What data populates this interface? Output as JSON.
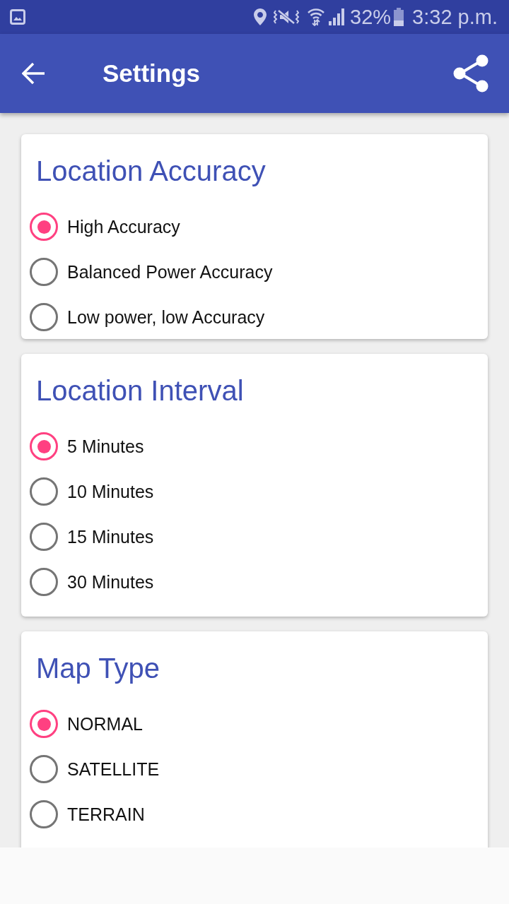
{
  "status_bar": {
    "battery": "32%",
    "time": "3:32 p.m."
  },
  "app_bar": {
    "title": "Settings"
  },
  "sections": [
    {
      "title": "Location Accuracy",
      "options": [
        {
          "label": "High Accuracy",
          "selected": true
        },
        {
          "label": "Balanced Power Accuracy",
          "selected": false
        },
        {
          "label": "Low power, low Accuracy",
          "selected": false
        }
      ]
    },
    {
      "title": "Location Interval",
      "options": [
        {
          "label": "5 Minutes",
          "selected": true
        },
        {
          "label": "10 Minutes",
          "selected": false
        },
        {
          "label": "15 Minutes",
          "selected": false
        },
        {
          "label": "30 Minutes",
          "selected": false
        }
      ]
    },
    {
      "title": "Map Type",
      "options": [
        {
          "label": "NORMAL",
          "selected": true
        },
        {
          "label": "SATELLITE",
          "selected": false
        },
        {
          "label": "TERRAIN",
          "selected": false
        }
      ]
    }
  ]
}
